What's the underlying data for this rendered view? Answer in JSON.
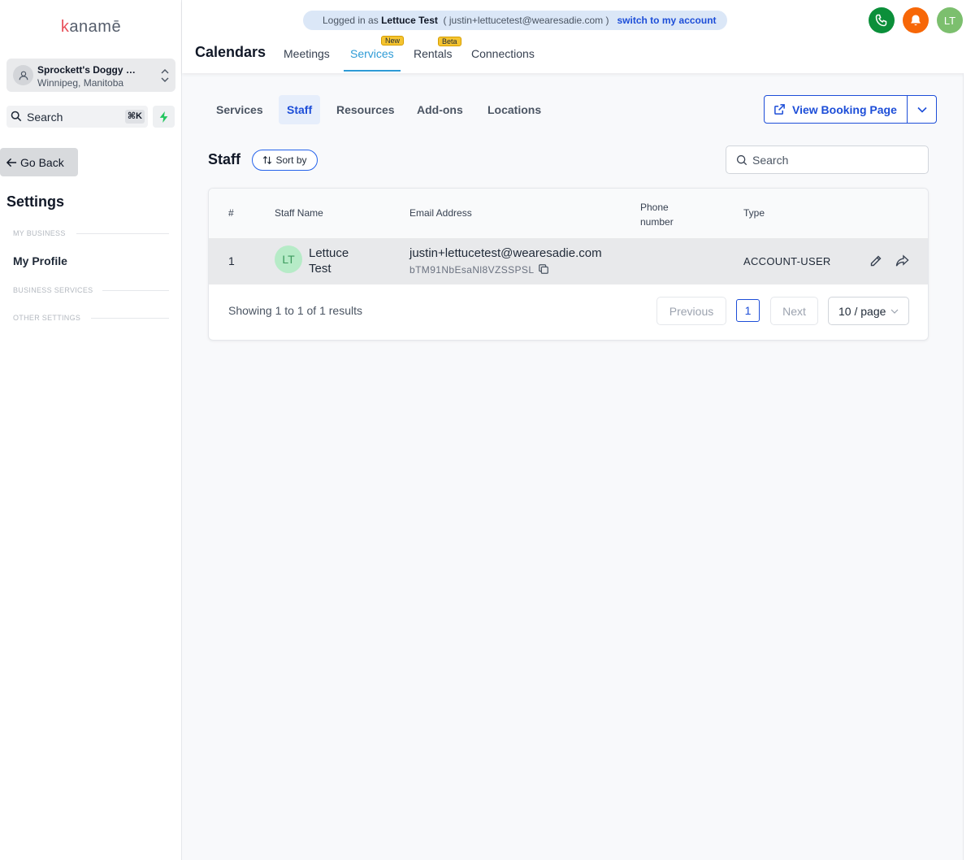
{
  "sidebar": {
    "logo": "kanamē",
    "business": {
      "name": "Sprockett's Doggy Daycare",
      "location": "Winnipeg, Manitoba"
    },
    "search": {
      "label": "Search",
      "shortcut": "⌘K"
    },
    "go_back": "Go Back",
    "settings_title": "Settings",
    "sections": [
      "MY BUSINESS",
      "BUSINESS SERVICES",
      "OTHER SETTINGS"
    ],
    "my_profile": "My Profile"
  },
  "topbar": {
    "impersonation": {
      "prefix": "Logged in as",
      "user": "Lettuce Test",
      "email": "( justin+lettucetest@wearesadie.com )",
      "switch_label": "switch to my account"
    },
    "avatar_initials": "LT",
    "heading": "Calendars",
    "tabs": [
      {
        "label": "Meetings"
      },
      {
        "label": "Services",
        "badge": "New",
        "active": true
      },
      {
        "label": "Rentals",
        "badge": "Beta"
      },
      {
        "label": "Connections"
      }
    ],
    "colors": {
      "phone": "#0b8f3a",
      "bell": "#f76707",
      "avatar": "#7cbf6e"
    }
  },
  "subtabs": [
    "Services",
    "Staff",
    "Resources",
    "Add-ons",
    "Locations"
  ],
  "active_subtab": "Staff",
  "booking_button": "View Booking Page",
  "staff": {
    "title": "Staff",
    "sort_label": "Sort by",
    "search_placeholder": "Search",
    "columns": [
      "#",
      "Staff Name",
      "Email Address",
      "Phone number",
      "Type"
    ],
    "rows": [
      {
        "index": "1",
        "initials": "LT",
        "name": "Lettuce Test",
        "email": "justin+lettucetest@wearesadie.com",
        "code": "bTM91NbEsaNl8VZSSPSL",
        "phone": "",
        "type": "ACCOUNT-USER"
      }
    ],
    "pagination": {
      "summary": "Showing 1 to 1 of 1 results",
      "previous": "Previous",
      "page": "1",
      "next": "Next",
      "per_page": "10 / page"
    }
  }
}
